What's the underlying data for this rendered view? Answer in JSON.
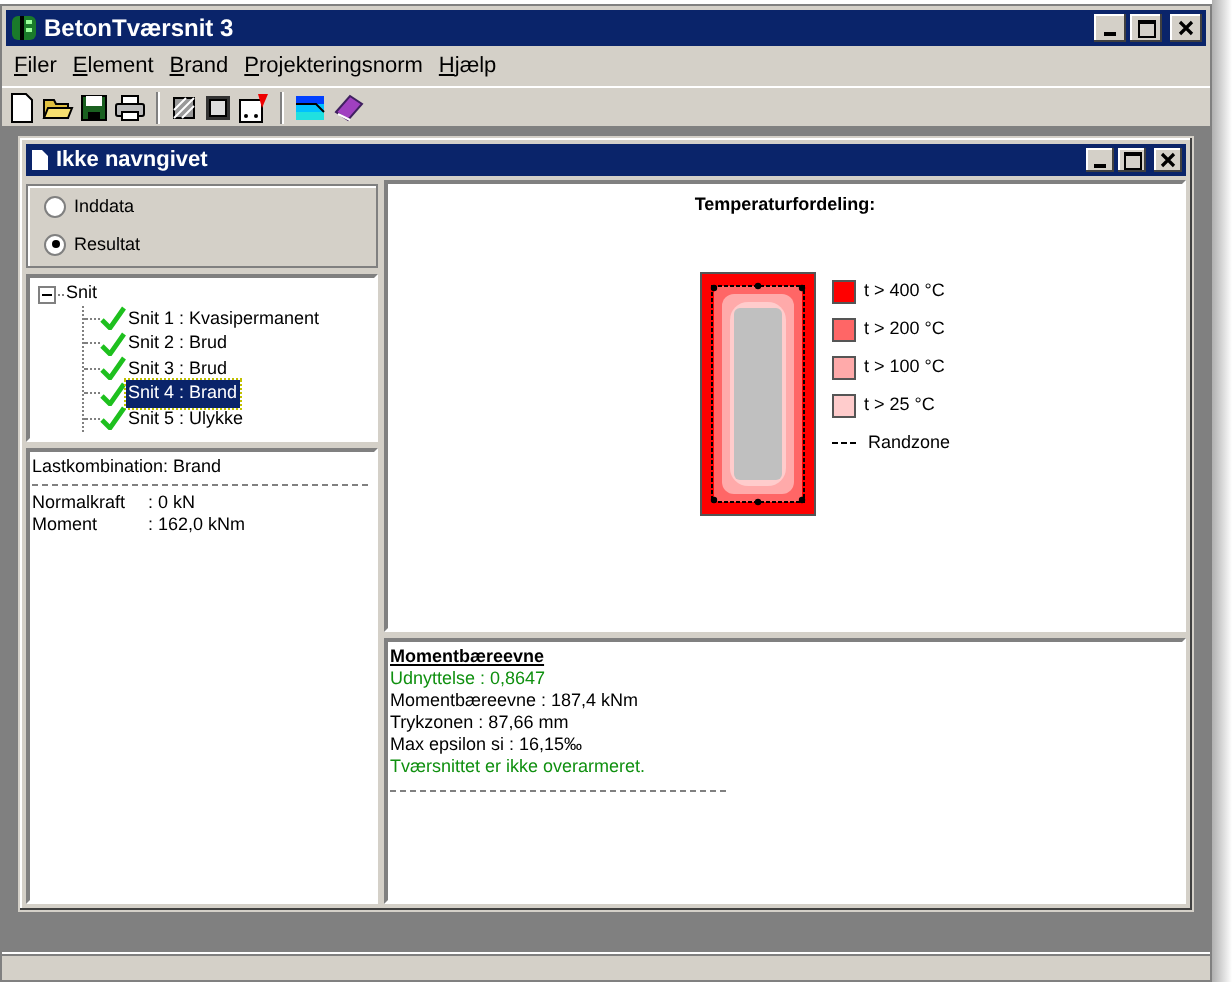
{
  "window": {
    "title": "BetonTværsnit 3"
  },
  "menu": [
    "Filer",
    "Element",
    "Brand",
    "Projekteringsnorm",
    "Hjælp"
  ],
  "document": {
    "title": "Ikke navngivet"
  },
  "view_mode": [
    {
      "label": "Inddata",
      "selected": false
    },
    {
      "label": "Resultat",
      "selected": true
    }
  ],
  "tree": {
    "label": "Snit",
    "expanded": true,
    "children": [
      {
        "label": "Snit 1 : Kvasipermanent",
        "selected": false
      },
      {
        "label": "Snit 2 : Brud",
        "selected": false
      },
      {
        "label": "Snit 3 : Brud",
        "selected": false
      },
      {
        "label": "Snit 4 : Brand",
        "selected": true
      },
      {
        "label": "Snit 5 : Ulykke",
        "selected": false
      }
    ]
  },
  "load": {
    "title": "Lastkombination: Brand",
    "rows": [
      {
        "name": "Normalkraft",
        "value": ": 0 kN"
      },
      {
        "name": "Moment",
        "value": ": 162,0 kNm"
      }
    ]
  },
  "temperature": {
    "title": "Temperaturfordeling:",
    "legend": [
      {
        "kind": "swatch",
        "label": "t > 400 °C",
        "color": "#ff0000"
      },
      {
        "kind": "swatch",
        "label": "t > 200 °C",
        "color": "#ff6666"
      },
      {
        "kind": "swatch",
        "label": "t > 100 °C",
        "color": "#ffaaaa"
      },
      {
        "kind": "swatch",
        "label": "t > 25 °C",
        "color": "#ffcccc"
      },
      {
        "kind": "line",
        "label": "Randzone"
      }
    ]
  },
  "result": {
    "title": "Momentbæreevne",
    "lines": [
      {
        "kind": "good",
        "text": "Udnyttelse : 0,8647"
      },
      {
        "kind": "plain",
        "text": "Momentbæreevne : 187,4 kNm"
      },
      {
        "kind": "plain",
        "text": "Trykzonen : 87,66 mm"
      },
      {
        "kind": "plain",
        "text": "Max epsilon si : 16,15‰"
      },
      {
        "kind": "good",
        "text": "Tværsnittet er ikke overarmeret."
      }
    ]
  }
}
